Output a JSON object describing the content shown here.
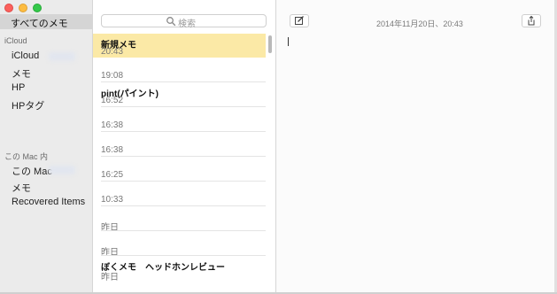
{
  "sidebar": {
    "all_notes": "すべてのメモ",
    "icloud_header": "iCloud",
    "icloud_items": [
      "iCloud",
      "メモ",
      "HP",
      "HPタグ"
    ],
    "mac_header": "この Mac 内",
    "mac_items": [
      "この Mac",
      "メモ",
      "Recovered Items"
    ]
  },
  "search": {
    "placeholder": "検索"
  },
  "notes": [
    {
      "title": "新規メモ",
      "time": "20:43"
    },
    {
      "title": "",
      "time": "19:08"
    },
    {
      "title": "pint(パイント)",
      "time": "16:52"
    },
    {
      "title": "",
      "time": "16:38"
    },
    {
      "title": "",
      "time": "16:38"
    },
    {
      "title": "",
      "time": "16:25"
    },
    {
      "title": "",
      "time": "10:33"
    },
    {
      "title": "",
      "time": "昨日"
    },
    {
      "title": "",
      "time": "昨日"
    },
    {
      "title": "ぼくメモ　ヘッドホンレビュー",
      "time": "昨日"
    }
  ],
  "editor": {
    "date": "2014年11月20日、20:43"
  },
  "colors": {
    "selected_note": "#fbe9a6",
    "sidebar_bg": "#ebebeb"
  },
  "icons": [
    "search-icon",
    "compose-icon",
    "share-icon"
  ]
}
